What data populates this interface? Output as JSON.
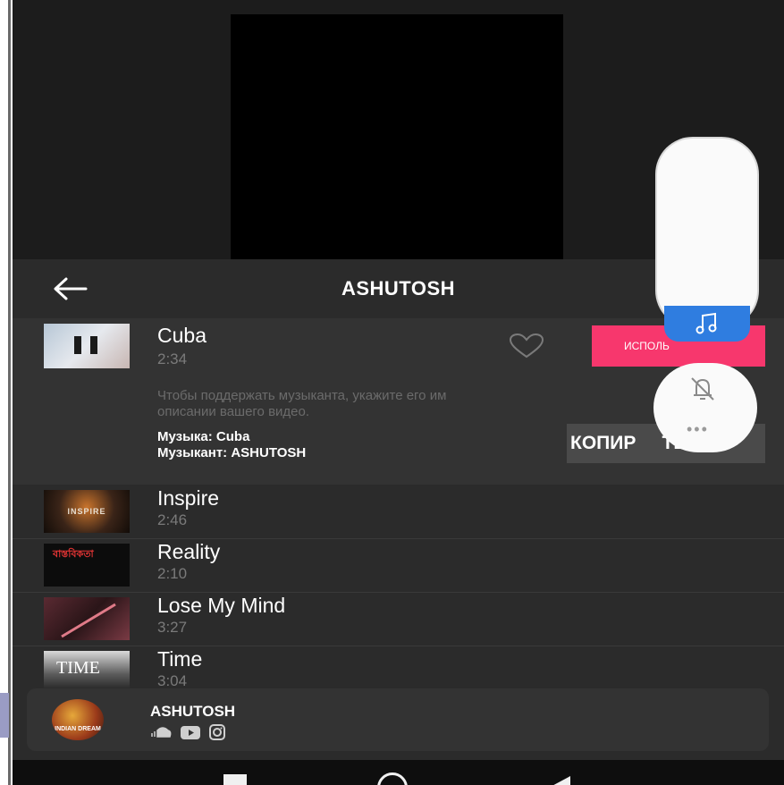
{
  "header": {
    "title": "ASHUTOSH"
  },
  "active_track": {
    "name": "Cuba",
    "duration": "2:34",
    "use_label": "ИСПОЛЬ",
    "notice": "Чтобы поддержать музыканта, укажите его им\nописании вашего видео.",
    "credit_music": "Музыка: Cuba",
    "credit_artist": "Музыкант: ASHUTOSH",
    "copy_label": "КОПИР     ТЬ"
  },
  "tracks": [
    {
      "name": "Inspire",
      "duration": "2:46",
      "thumb_text": "INSPIRE"
    },
    {
      "name": "Reality",
      "duration": "2:10",
      "thumb_text": "বাস্তবিকতা"
    },
    {
      "name": "Lose My Mind",
      "duration": "3:27",
      "thumb_text": ""
    },
    {
      "name": "Time",
      "duration": "3:04",
      "thumb_text": "TIME"
    }
  ],
  "artist_bar": {
    "name": "ASHUTOSH",
    "avatar_text": "INDIAN DREAM"
  },
  "colors": {
    "accent": "#f7376d",
    "music_tab": "#2f7de0",
    "panel": "#2b2b2b"
  },
  "icons": [
    "back-arrow-icon",
    "pause-icon",
    "heart-icon",
    "music-note-icon",
    "bell-off-icon",
    "more-icon",
    "soundcloud-icon",
    "youtube-icon",
    "instagram-icon"
  ]
}
